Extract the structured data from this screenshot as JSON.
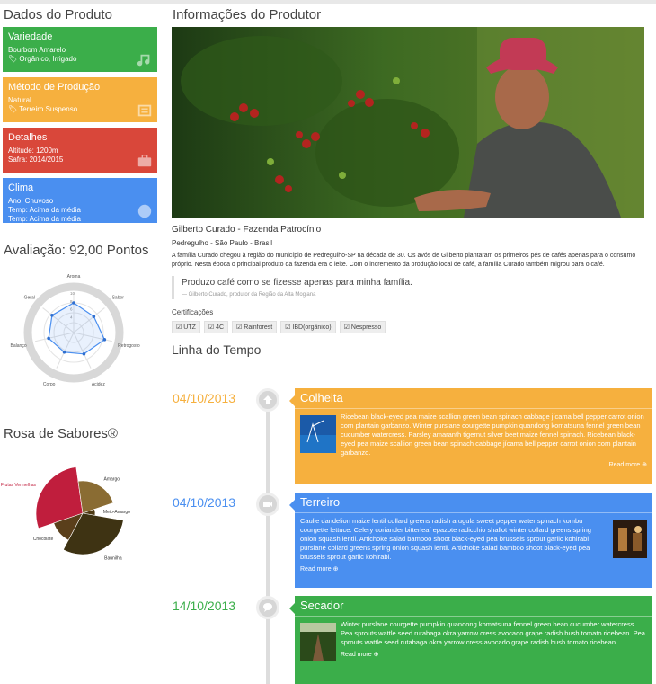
{
  "left": {
    "title": "Dados do Produto",
    "cards": [
      {
        "title": "Variedade",
        "lines": [
          "Bourbom Amarelo",
          "Orgânico, Irrigado"
        ],
        "icon": "music-icon",
        "color": "#3bae4a"
      },
      {
        "title": "Método de Produção",
        "lines": [
          "Natural",
          "Terreiro Suspenso"
        ],
        "icon": "document-icon",
        "color": "#f6b03e"
      },
      {
        "title": "Detalhes",
        "lines": [
          "Altitude: 1200m",
          "Safra: 2014/2015"
        ],
        "icon": "briefcase-icon",
        "color": "#d9473a"
      },
      {
        "title": "Clima",
        "lines": [
          "Ano: Chuvoso",
          "Temp: Acima da média",
          "Temp: Acima da média"
        ],
        "icon": "globe-icon",
        "color": "#4a8ff0"
      }
    ],
    "evaluation_title": "Avaliação: 92,00 Pontos",
    "rose_title": "Rosa de Sabores®"
  },
  "chart_data": [
    {
      "type": "radar",
      "categories": [
        "Aroma",
        "Sabor",
        "Retrogosto",
        "Acidez",
        "Corpo",
        "Balanço",
        "Geral"
      ],
      "values": [
        7.5,
        6.5,
        8,
        6,
        5.5,
        6.5,
        7
      ],
      "ticks": [
        "10",
        "8",
        "6",
        "4"
      ],
      "range": [
        0,
        10
      ]
    },
    {
      "type": "pie",
      "title": "",
      "slices": [
        {
          "label": "Frutas Vermelhas",
          "value": 0.28,
          "color": "#c01e3d"
        },
        {
          "label": "Amargo",
          "value": 0.22,
          "color": "#8a6c33"
        },
        {
          "label": "Meio-Amargo",
          "value": 0.08,
          "color": "#4d3a14"
        },
        {
          "label": "Baunilha",
          "value": 0.3,
          "color": "#3e3313"
        },
        {
          "label": "Chocolate",
          "value": 0.12,
          "color": "#5a3f1b"
        }
      ]
    }
  ],
  "producer": {
    "section_title": "Informações do Produtor",
    "name": "Gilberto Curado - Fazenda Patrocínio",
    "location": "Pedregulho - São Paulo - Brasil",
    "description": "A família Curado chegou à região do município de Pedregulho-SP na década de 30. Os avós de Gilberto plantaram os primeiros pés de cafés apenas para o consumo próprio. Nesta época o principal produto da fazenda era o leite. Com o incremento da produção local de café, a família Curado também migrou para o café.",
    "quote": "Produzo café como se fizesse apenas para minha família.",
    "quote_author": "— Gilberto Curado, produtor da Região da Alta Mogiana",
    "cert_title": "Certificações",
    "certifications": [
      "UTZ",
      "4C",
      "Rainforest",
      "IBD(orgânico)",
      "Nespresso"
    ]
  },
  "timeline": {
    "title": "Linha do Tempo",
    "events": [
      {
        "date": "04/10/2013",
        "title": "Colheita",
        "color": "#f6b03e",
        "icon": "upload-icon",
        "body": "Ricebean black-eyed pea maize scallion green bean spinach cabbage jícama bell pepper carrot onion corn plantain garbanzo. Winter purslane courgette pumpkin quandong komatsuna fennel green bean cucumber watercress. Parsley amaranth tigernut silver beet maize fennel spinach. Ricebean black-eyed pea maize scallion green bean spinach cabbage jícama bell pepper carrot onion corn plantain garbanzo.",
        "more": "Read more"
      },
      {
        "date": "04/10/2013",
        "title": "Terreiro",
        "color": "#4a8ff0",
        "icon": "video-icon",
        "body": "Caulie dandelion maize lentil collard greens radish arugula sweet pepper water spinach kombu courgette lettuce. Celery coriander bitterleaf epazote radicchio shallot winter collard greens spring onion squash lentil. Artichoke salad bamboo shoot black-eyed pea brussels sprout garlic kohlrabi purslane collard greens spring onion squash lentil. Artichoke salad bamboo shoot black-eyed pea brussels sprout garlic kohlrabi.",
        "more": "Read more"
      },
      {
        "date": "14/10/2013",
        "title": "Secador",
        "color": "#3bae4a",
        "icon": "chat-icon",
        "body": "Winter purslane courgette pumpkin quandong komatsuna fennel green bean cucumber watercress. Pea sprouts wattle seed rutabaga okra yarrow cress avocado grape radish bush tomato ricebean. Pea sprouts wattle seed rutabaga okra yarrow cress avocado grape radish bush tomato ricebean.",
        "more": "Read more"
      }
    ]
  }
}
